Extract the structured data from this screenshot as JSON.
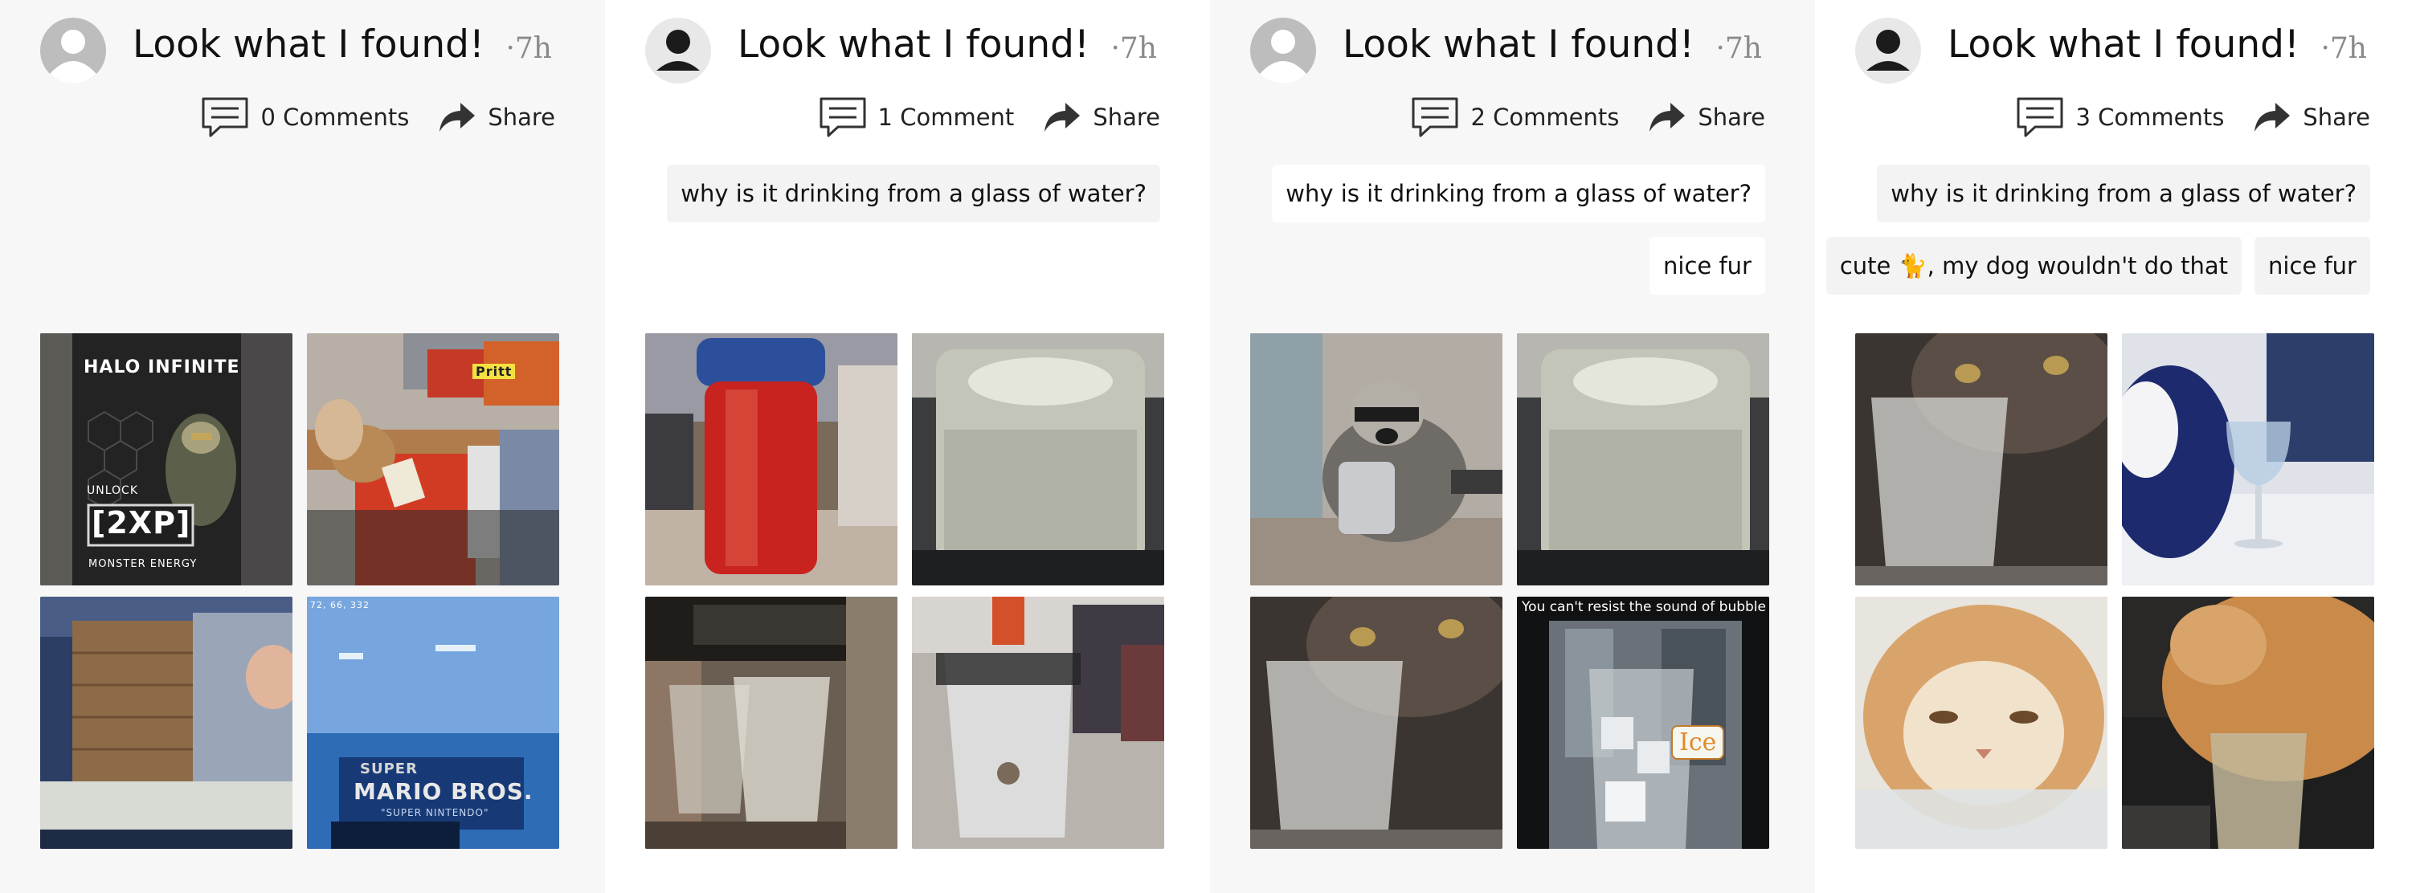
{
  "posts": [
    {
      "title": "Look what I found!",
      "time": "·7h",
      "comment_count_label": "0 Comments",
      "share_label": "Share",
      "comment_rows": []
    },
    {
      "title": "Look what I found!",
      "time": "·7h",
      "comment_count_label": "1 Comment",
      "share_label": "Share",
      "comment_rows": [
        [
          "why is it drinking from a glass of water?"
        ]
      ]
    },
    {
      "title": "Look what I found!",
      "time": "·7h",
      "comment_count_label": "2 Comments",
      "share_label": "Share",
      "comment_rows": [
        [
          "why is it drinking from a glass of water?"
        ],
        [
          "nice fur"
        ]
      ]
    },
    {
      "title": "Look what I found!",
      "time": "·7h",
      "comment_count_label": "3 Comments",
      "share_label": "Share",
      "comment_rows": [
        [
          "why is it drinking from a glass of water?"
        ],
        [
          "cute 🐈, my dog wouldn't do that",
          "nice fur"
        ]
      ]
    }
  ],
  "image_texts": {
    "halo_brand": "HALO INFINITE",
    "halo_unlock": "UNLOCK",
    "halo_2xp": "[2XP]",
    "halo_monster": "MONSTER ENERGY",
    "pritt": "Pritt",
    "mario_coords": "72, 66, 332",
    "mario_logo_top": "SUPER",
    "mario_logo_bottom": "MARIO BROS.",
    "mario_sub": "\"SUPER NINTENDO\"",
    "bubble_caption": "You can't resist the sound of bubble",
    "ice_label": "Ice"
  },
  "colors": {
    "panel_alt_bg": "#f7f7f7",
    "bubble_bg": "#f3f3f3",
    "title": "#111111",
    "time": "#8a8a8a"
  },
  "icons": {
    "comment": "comment-bubble-icon",
    "share": "share-arrow-icon",
    "avatar": "user-avatar-icon"
  }
}
